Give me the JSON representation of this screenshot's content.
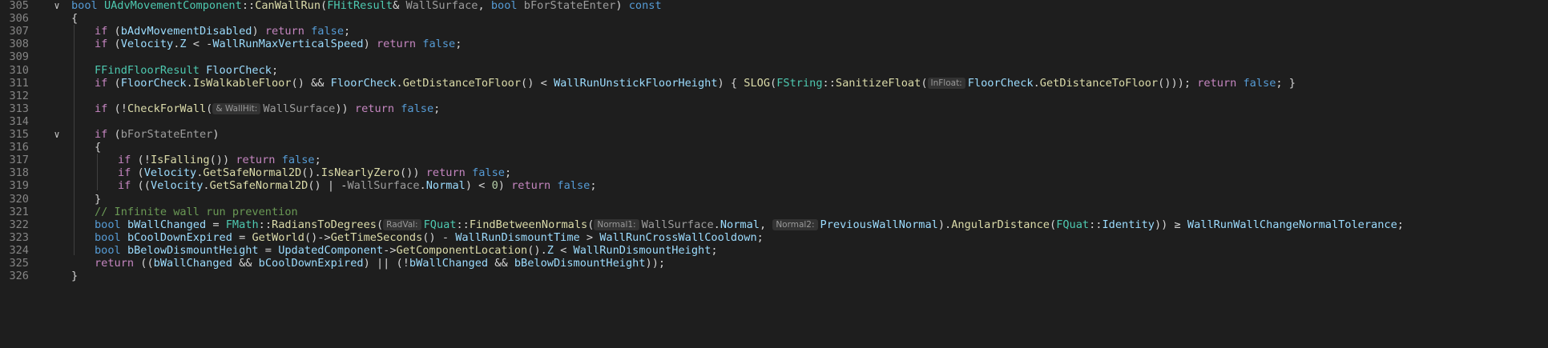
{
  "editor": {
    "lines": [
      {
        "no": "305",
        "fold": true,
        "indent": 0,
        "tokens": [
          [
            "kw",
            "bool"
          ],
          [
            "p",
            " "
          ],
          [
            "type",
            "UAdvMovementComponent"
          ],
          [
            "p",
            "::"
          ],
          [
            "fn",
            "CanWallRun"
          ],
          [
            "p",
            "("
          ],
          [
            "type",
            "FHitResult"
          ],
          [
            "p",
            "& "
          ],
          [
            "dim",
            "WallSurface"
          ],
          [
            "p",
            ", "
          ],
          [
            "kw",
            "bool"
          ],
          [
            "p",
            " "
          ],
          [
            "dim",
            "bForStateEnter"
          ],
          [
            "p",
            ") "
          ],
          [
            "kw",
            "const"
          ]
        ]
      },
      {
        "no": "306",
        "fold": false,
        "indent": 0,
        "tokens": [
          [
            "p",
            "{"
          ]
        ]
      },
      {
        "no": "307",
        "fold": false,
        "indent": 1,
        "tokens": [
          [
            "ctl",
            "if"
          ],
          [
            "p",
            " ("
          ],
          [
            "mem",
            "bAdvMovementDisabled"
          ],
          [
            "p",
            ") "
          ],
          [
            "ctl",
            "return"
          ],
          [
            "p",
            " "
          ],
          [
            "kw",
            "false"
          ],
          [
            "p",
            ";"
          ]
        ]
      },
      {
        "no": "308",
        "fold": false,
        "indent": 1,
        "tokens": [
          [
            "ctl",
            "if"
          ],
          [
            "p",
            " ("
          ],
          [
            "mem",
            "Velocity"
          ],
          [
            "p",
            "."
          ],
          [
            "mem",
            "Z"
          ],
          [
            "p",
            " < -"
          ],
          [
            "mem",
            "WallRunMaxVerticalSpeed"
          ],
          [
            "p",
            ") "
          ],
          [
            "ctl",
            "return"
          ],
          [
            "p",
            " "
          ],
          [
            "kw",
            "false"
          ],
          [
            "p",
            ";"
          ]
        ]
      },
      {
        "no": "309",
        "fold": false,
        "indent": 1,
        "tokens": []
      },
      {
        "no": "310",
        "fold": false,
        "indent": 1,
        "tokens": [
          [
            "type",
            "FFindFloorResult"
          ],
          [
            "p",
            " "
          ],
          [
            "mem",
            "FloorCheck"
          ],
          [
            "p",
            ";"
          ]
        ]
      },
      {
        "no": "311",
        "fold": false,
        "indent": 1,
        "tokens": [
          [
            "ctl",
            "if"
          ],
          [
            "p",
            " ("
          ],
          [
            "mem",
            "FloorCheck"
          ],
          [
            "p",
            "."
          ],
          [
            "fn",
            "IsWalkableFloor"
          ],
          [
            "p",
            "() && "
          ],
          [
            "mem",
            "FloorCheck"
          ],
          [
            "p",
            "."
          ],
          [
            "fn",
            "GetDistanceToFloor"
          ],
          [
            "p",
            "() < "
          ],
          [
            "mem",
            "WallRunUnstickFloorHeight"
          ],
          [
            "p",
            ") { "
          ],
          [
            "fn",
            "SLOG"
          ],
          [
            "p",
            "("
          ],
          [
            "type",
            "FString"
          ],
          [
            "p",
            "::"
          ],
          [
            "fn",
            "SanitizeFloat"
          ],
          [
            "p",
            "("
          ],
          [
            "hint",
            "InFloat:"
          ],
          [
            "mem",
            "FloorCheck"
          ],
          [
            "p",
            "."
          ],
          [
            "fn",
            "GetDistanceToFloor"
          ],
          [
            "p",
            "())); "
          ],
          [
            "ctl",
            "return"
          ],
          [
            "p",
            " "
          ],
          [
            "kw",
            "false"
          ],
          [
            "p",
            "; }"
          ]
        ]
      },
      {
        "no": "312",
        "fold": false,
        "indent": 1,
        "tokens": []
      },
      {
        "no": "313",
        "fold": false,
        "indent": 1,
        "tokens": [
          [
            "ctl",
            "if"
          ],
          [
            "p",
            " (!"
          ],
          [
            "fn",
            "CheckForWall"
          ],
          [
            "p",
            "("
          ],
          [
            "hint",
            "& WallHit:"
          ],
          [
            "dim",
            "WallSurface"
          ],
          [
            "p",
            ")) "
          ],
          [
            "ctl",
            "return"
          ],
          [
            "p",
            " "
          ],
          [
            "kw",
            "false"
          ],
          [
            "p",
            ";"
          ]
        ]
      },
      {
        "no": "314",
        "fold": false,
        "indent": 1,
        "tokens": []
      },
      {
        "no": "315",
        "fold": true,
        "indent": 1,
        "tokens": [
          [
            "ctl",
            "if"
          ],
          [
            "p",
            " ("
          ],
          [
            "dim",
            "bForStateEnter"
          ],
          [
            "p",
            ")"
          ]
        ]
      },
      {
        "no": "316",
        "fold": false,
        "indent": 1,
        "tokens": [
          [
            "p",
            "{"
          ]
        ]
      },
      {
        "no": "317",
        "fold": false,
        "indent": 2,
        "tokens": [
          [
            "ctl",
            "if"
          ],
          [
            "p",
            " (!"
          ],
          [
            "fn",
            "IsFalling"
          ],
          [
            "p",
            "()) "
          ],
          [
            "ctl",
            "return"
          ],
          [
            "p",
            " "
          ],
          [
            "kw",
            "false"
          ],
          [
            "p",
            ";"
          ]
        ]
      },
      {
        "no": "318",
        "fold": false,
        "indent": 2,
        "tokens": [
          [
            "ctl",
            "if"
          ],
          [
            "p",
            " ("
          ],
          [
            "mem",
            "Velocity"
          ],
          [
            "p",
            "."
          ],
          [
            "fn",
            "GetSafeNormal2D"
          ],
          [
            "p",
            "()."
          ],
          [
            "fn",
            "IsNearlyZero"
          ],
          [
            "p",
            "()) "
          ],
          [
            "ctl",
            "return"
          ],
          [
            "p",
            " "
          ],
          [
            "kw",
            "false"
          ],
          [
            "p",
            ";"
          ]
        ]
      },
      {
        "no": "319",
        "fold": false,
        "indent": 2,
        "tokens": [
          [
            "ctl",
            "if"
          ],
          [
            "p",
            " (("
          ],
          [
            "mem",
            "Velocity"
          ],
          [
            "p",
            "."
          ],
          [
            "fn",
            "GetSafeNormal2D"
          ],
          [
            "p",
            "() | -"
          ],
          [
            "dim",
            "WallSurface"
          ],
          [
            "p",
            "."
          ],
          [
            "mem",
            "Normal"
          ],
          [
            "p",
            ") < "
          ],
          [
            "num",
            "0"
          ],
          [
            "p",
            ") "
          ],
          [
            "ctl",
            "return"
          ],
          [
            "p",
            " "
          ],
          [
            "kw",
            "false"
          ],
          [
            "p",
            ";"
          ]
        ]
      },
      {
        "no": "320",
        "fold": false,
        "indent": 1,
        "tokens": [
          [
            "p",
            "}"
          ]
        ]
      },
      {
        "no": "321",
        "fold": false,
        "indent": 1,
        "tokens": [
          [
            "cmt",
            "// Infinite wall run prevention"
          ]
        ]
      },
      {
        "no": "322",
        "fold": false,
        "indent": 1,
        "tokens": [
          [
            "kw",
            "bool"
          ],
          [
            "p",
            " "
          ],
          [
            "mem",
            "bWallChanged"
          ],
          [
            "p",
            " = "
          ],
          [
            "type",
            "FMath"
          ],
          [
            "p",
            "::"
          ],
          [
            "fn",
            "RadiansToDegrees"
          ],
          [
            "p",
            "("
          ],
          [
            "hint",
            "RadVal:"
          ],
          [
            "type",
            "FQuat"
          ],
          [
            "p",
            "::"
          ],
          [
            "fn",
            "FindBetweenNormals"
          ],
          [
            "p",
            "("
          ],
          [
            "hint",
            "Normal1:"
          ],
          [
            "dim",
            "WallSurface"
          ],
          [
            "p",
            "."
          ],
          [
            "mem",
            "Normal"
          ],
          [
            "p",
            ", "
          ],
          [
            "hint",
            "Normal2:"
          ],
          [
            "mem",
            "PreviousWallNormal"
          ],
          [
            "p",
            ")."
          ],
          [
            "fn",
            "AngularDistance"
          ],
          [
            "p",
            "("
          ],
          [
            "type",
            "FQuat"
          ],
          [
            "p",
            "::"
          ],
          [
            "mem",
            "Identity"
          ],
          [
            "p",
            ")) ≥ "
          ],
          [
            "mem",
            "WallRunWallChangeNormalTolerance"
          ],
          [
            "p",
            ";"
          ]
        ]
      },
      {
        "no": "323",
        "fold": false,
        "indent": 1,
        "tokens": [
          [
            "kw",
            "bool"
          ],
          [
            "p",
            " "
          ],
          [
            "mem",
            "bCoolDownExpired"
          ],
          [
            "p",
            " = "
          ],
          [
            "fn",
            "GetWorld"
          ],
          [
            "p",
            "()->"
          ],
          [
            "fn",
            "GetTimeSeconds"
          ],
          [
            "p",
            "() - "
          ],
          [
            "mem",
            "WallRunDismountTime"
          ],
          [
            "p",
            " > "
          ],
          [
            "mem",
            "WallRunCrossWallCooldown"
          ],
          [
            "p",
            ";"
          ]
        ]
      },
      {
        "no": "324",
        "fold": false,
        "indent": 1,
        "tokens": [
          [
            "kw",
            "bool"
          ],
          [
            "p",
            " "
          ],
          [
            "mem",
            "bBelowDismountHeight"
          ],
          [
            "p",
            " = "
          ],
          [
            "mem",
            "UpdatedComponent"
          ],
          [
            "p",
            "->"
          ],
          [
            "fn",
            "GetComponentLocation"
          ],
          [
            "p",
            "()."
          ],
          [
            "mem",
            "Z"
          ],
          [
            "p",
            " < "
          ],
          [
            "mem",
            "WallRunDismountHeight"
          ],
          [
            "p",
            ";"
          ]
        ]
      },
      {
        "no": "325",
        "fold": false,
        "indent": 1,
        "tokens": [
          [
            "ctl",
            "return"
          ],
          [
            "p",
            " (("
          ],
          [
            "mem",
            "bWallChanged"
          ],
          [
            "p",
            " && "
          ],
          [
            "mem",
            "bCoolDownExpired"
          ],
          [
            "p",
            ") || (!"
          ],
          [
            "mem",
            "bWallChanged"
          ],
          [
            "p",
            " && "
          ],
          [
            "mem",
            "bBelowDismountHeight"
          ],
          [
            "p",
            "));"
          ]
        ]
      },
      {
        "no": "326",
        "fold": false,
        "indent": 0,
        "tokens": [
          [
            "p",
            "}"
          ]
        ]
      }
    ]
  }
}
